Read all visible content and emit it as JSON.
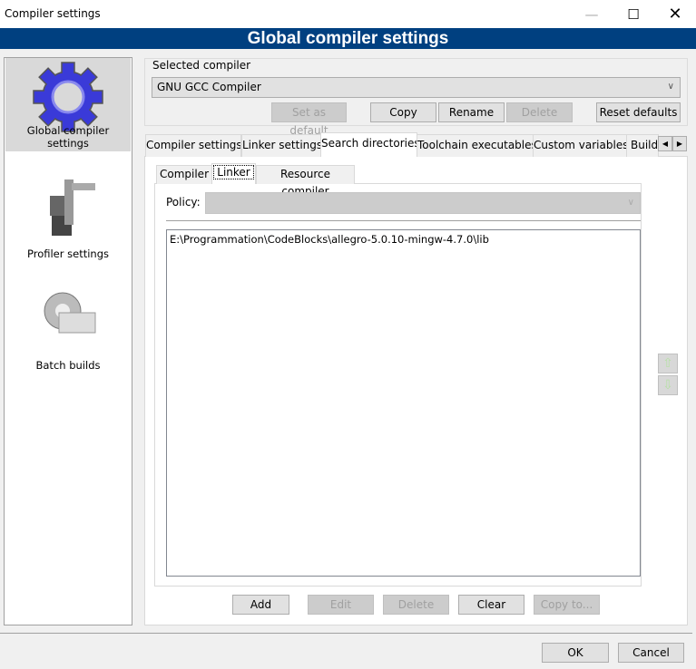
{
  "window": {
    "title": "Compiler settings",
    "minimize_icon": "minimize-icon",
    "maximize_icon": "maximize-icon",
    "close_icon": "close-icon"
  },
  "banner": {
    "title": "Global compiler settings",
    "color": "#004080"
  },
  "sidebar": {
    "items": [
      {
        "label": "Global compiler settings",
        "icon": "gear-icon",
        "selected": true
      },
      {
        "label": "Profiler settings",
        "icon": "profiler-icon"
      },
      {
        "label": "Batch builds",
        "icon": "batch-build-icon"
      }
    ]
  },
  "compiler": {
    "group_label": "Selected compiler",
    "selected": "GNU GCC Compiler",
    "buttons": {
      "set_default": "Set as default",
      "copy": "Copy",
      "rename": "Rename",
      "delete": "Delete",
      "reset": "Reset defaults"
    }
  },
  "tabs": [
    "Compiler settings",
    "Linker settings",
    "Search directories",
    "Toolchain executables",
    "Custom variables",
    "Build"
  ],
  "active_tab": "Search directories",
  "subtabs": [
    "Compiler",
    "Linker",
    "Resource compiler"
  ],
  "active_subtab": "Linker",
  "policy": {
    "label": "Policy:",
    "value": ""
  },
  "directories": [
    "E:\\Programmation\\CodeBlocks\\allegro-5.0.10-mingw-4.7.0\\lib"
  ],
  "list_buttons": {
    "add": "Add",
    "edit": "Edit",
    "delete": "Delete",
    "clear": "Clear",
    "copy_to": "Copy to..."
  },
  "dialog": {
    "ok": "OK",
    "cancel": "Cancel"
  }
}
